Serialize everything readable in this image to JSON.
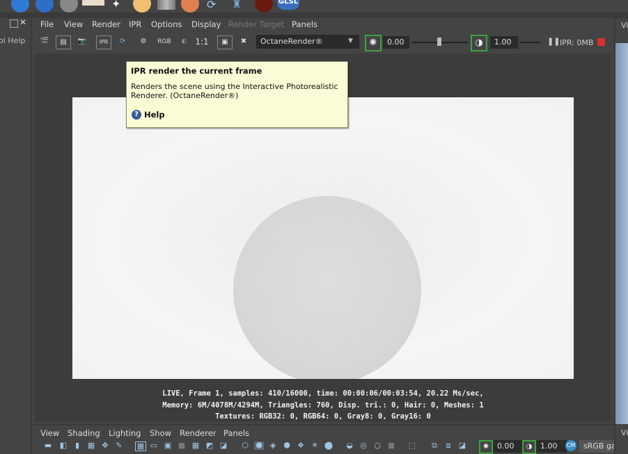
{
  "shelf": {
    "glsl_label": "GLSL"
  },
  "left_panel": {
    "label": "ol Help"
  },
  "menubar": {
    "items": [
      "File",
      "View",
      "Render",
      "IPR",
      "Options",
      "Display",
      "Render Target",
      "Panels"
    ]
  },
  "toolbar": {
    "rgb_label": "RGB",
    "ratio_label": "1:1",
    "renderer": "OctaneRender®",
    "exposure_value": "0.00",
    "gamma_value": "1.00",
    "ipr_status": "IPR: 0MB",
    "pause_icon": "pause-icon",
    "stop_color": "#d63030"
  },
  "tooltip": {
    "title": "IPR render the current frame",
    "description": "Renders the scene using the Interactive Photorealistic Renderer. (OctaneRender®)",
    "help_label": "Help"
  },
  "stats": {
    "line1": "LIVE, Frame 1, samples: 410/16000, time: 00:00:06/00:03:54, 20.22 Ms/sec,",
    "line2": "Memory: 6M/4078M/4294M, Triangles: 760, Disp. tri.: 0, Hair: 0, Meshes: 1",
    "line3": "Textures: RGB32: 0, RGB64: 0, Gray8: 0, Gray16: 0"
  },
  "bottom_panel": {
    "menu_items": [
      "View",
      "Shading",
      "Lighting",
      "Show",
      "Renderer",
      "Panels"
    ],
    "exposure_value": "0.00",
    "gamma_value": "1.00",
    "color_space": "sRGB ga"
  },
  "right_panel": {
    "label_top": "Vi",
    "label_bottom": "Vi"
  },
  "colors": {
    "tooltip_bg": "#fbfbd5",
    "accent_green": "#3fa33f",
    "panel_bg": "#444444"
  }
}
